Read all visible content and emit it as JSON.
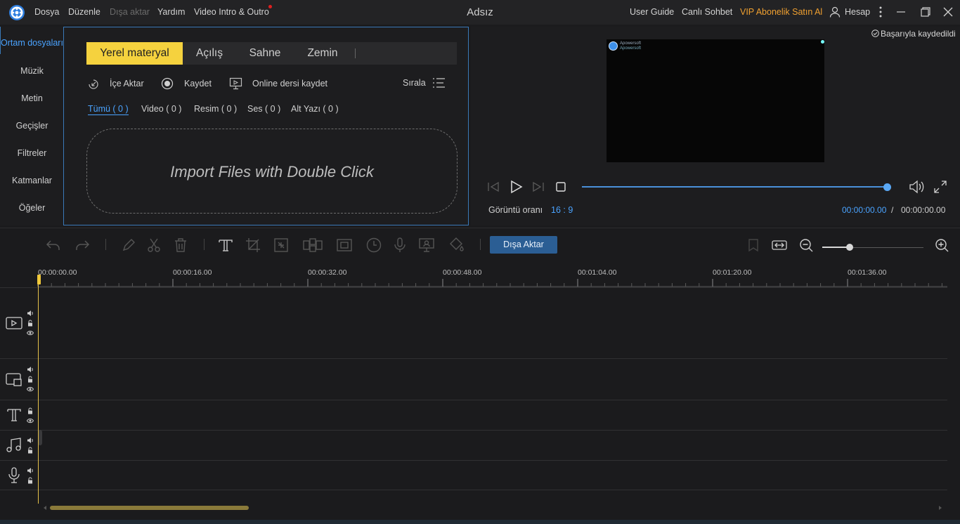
{
  "titlebar": {
    "app_title": "Adsız",
    "menus": [
      "Dosya",
      "Düzenle",
      "Dışa aktar",
      "Yardım",
      "Video Intro & Outro"
    ],
    "right_links": {
      "user_guide": "User Guide",
      "live_chat": "Canlı Sohbet",
      "vip": "VIP Abonelik Satın Al",
      "account": "Hesap"
    }
  },
  "sidebar": {
    "items": [
      "Ortam dosyaları",
      "Müzik",
      "Metin",
      "Geçişler",
      "Filtreler",
      "Katmanlar",
      "Öğeler"
    ],
    "active_index": 0
  },
  "media": {
    "tabs": [
      "Yerel materyal",
      "Açılış",
      "Sahne",
      "Zemin"
    ],
    "active_tab": 0,
    "actions": {
      "import": "İçe Aktar",
      "record": "Kaydet",
      "online_record": "Online dersi kaydet",
      "sort": "Sırala"
    },
    "filters": [
      "Tümü ( 0 )",
      "Video ( 0 )",
      "Resim ( 0 )",
      "Ses ( 0 )",
      "Alt Yazı ( 0 )"
    ],
    "active_filter": 0,
    "dropzone_text": "Import Files with Double Click"
  },
  "preview": {
    "saved_status": "Başarıyla kaydedildi",
    "watermark_line1": "Apowersoft",
    "watermark_line2": "Apowersoft",
    "aspect_label": "Görüntü oranı",
    "aspect_value": "16 : 9",
    "time_current": "00:00:00.00",
    "time_separator": "/",
    "time_total": "00:00:00.00",
    "progress": 1.0
  },
  "toolbar": {
    "export_label": "Dışa Aktar",
    "zoom_level": 0.27
  },
  "timeline": {
    "ruler_labels": [
      "00:00:00.00",
      "00:00:16.00",
      "00:00:32.00",
      "00:00:48.00",
      "00:01:04.00",
      "00:01:20.00",
      "00:01:36.00"
    ],
    "tracks": [
      "video-track",
      "overlay-track",
      "text-track",
      "music-track",
      "voice-track"
    ]
  },
  "colors": {
    "accent_blue": "#4aa3ff",
    "active_tab_yellow": "#f5d23e",
    "vip_orange": "#f0a030",
    "playhead": "#e6c24a",
    "export_button": "#2b5e94"
  }
}
